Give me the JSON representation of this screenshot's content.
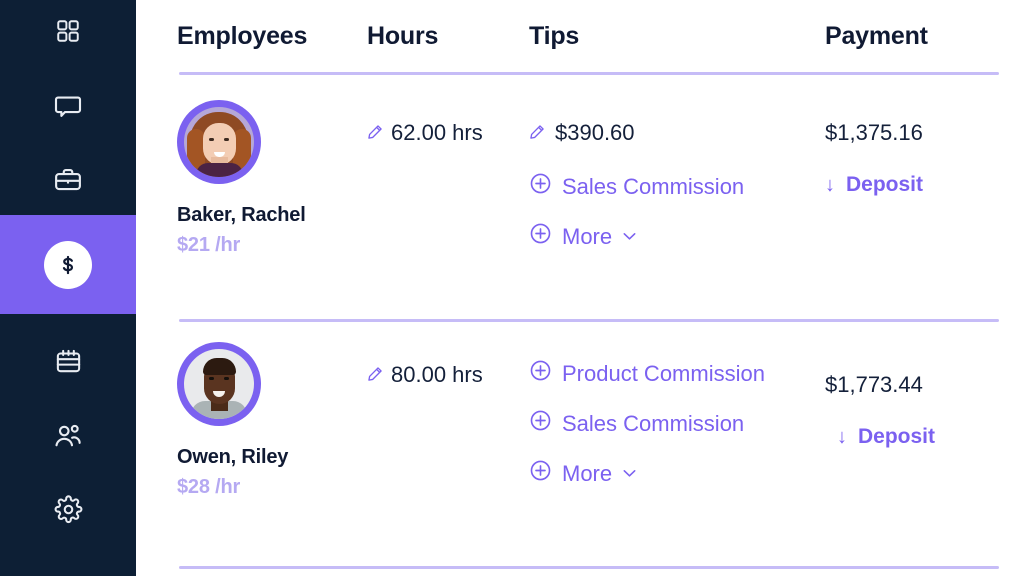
{
  "sidebar": {
    "background_color": "#0d1f35",
    "active_color": "#7b61f0",
    "items": [
      {
        "icon": "grid-dashboard-icon",
        "active": false
      },
      {
        "icon": "chat-bubble-icon",
        "active": false
      },
      {
        "icon": "briefcase-icon",
        "active": false
      },
      {
        "icon": "dollar-sign-icon",
        "active": true
      },
      {
        "icon": "calendar-icon",
        "active": false
      },
      {
        "icon": "people-icon",
        "active": false
      },
      {
        "icon": "gear-icon",
        "active": false
      }
    ]
  },
  "table": {
    "accent_color": "#7b61f0",
    "divider_color": "#c6bcf7",
    "headers": {
      "employees": "Employees",
      "hours": "Hours",
      "tips": "Tips",
      "payment": "Payment"
    },
    "rows": [
      {
        "name": "Baker, Rachel",
        "rate": "$21 /hr",
        "avatar": "avatar-rachel",
        "hours": {
          "icon": "pencil-edit-icon",
          "value": "62.00 hrs"
        },
        "tips": [
          {
            "icon": "pencil-edit-icon",
            "label": "$390.60",
            "style": "value"
          },
          {
            "icon": "plus-circle-icon",
            "label": "Sales Commission",
            "style": "link"
          },
          {
            "icon": "plus-circle-icon",
            "label": "More",
            "style": "link",
            "chevron": "⌄"
          }
        ],
        "payment": {
          "amount": "$1,375.16",
          "action_icon": "down-arrow-icon",
          "action_label": "Deposit"
        }
      },
      {
        "name": "Owen, Riley",
        "rate": "$28 /hr",
        "avatar": "avatar-riley",
        "hours": {
          "icon": "pencil-edit-icon",
          "value": "80.00 hrs"
        },
        "tips": [
          {
            "icon": "plus-circle-icon",
            "label": "Product Commission",
            "style": "link"
          },
          {
            "icon": "plus-circle-icon",
            "label": "Sales Commission",
            "style": "link"
          },
          {
            "icon": "plus-circle-icon",
            "label": "More",
            "style": "link",
            "chevron": "⌄"
          }
        ],
        "payment": {
          "amount": "$1,773.44",
          "action_icon": "down-arrow-icon",
          "action_label": "Deposit"
        }
      }
    ]
  }
}
